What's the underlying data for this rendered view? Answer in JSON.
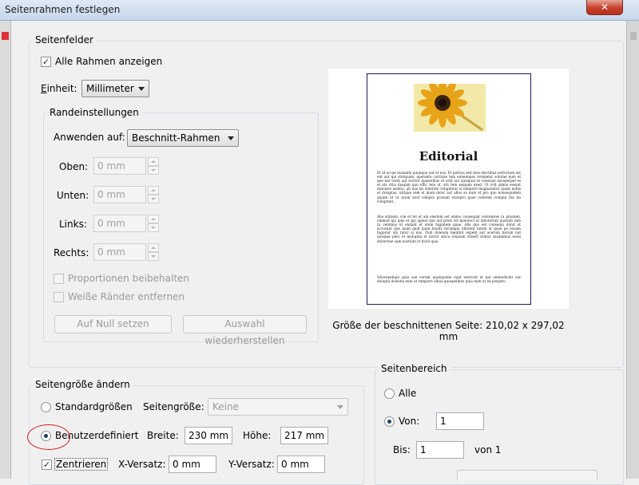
{
  "window": {
    "title": "Seitenrahmen festlegen",
    "close_glyph": "✕"
  },
  "seitenfelder": {
    "legend": "Seitenfelder",
    "show_all": {
      "label": "Alle Rahmen anzeigen",
      "checked": true
    },
    "unit": {
      "label_prefix": "",
      "label_accel": "E",
      "label_rest": "inheit:",
      "value": "Millimeter"
    },
    "rand": {
      "legend": "Randeinstellungen",
      "apply_label": "Anwenden auf:",
      "apply_value": "Beschnitt-Rahmen",
      "fields": [
        {
          "label": "Oben:",
          "value": "0 mm"
        },
        {
          "label": "Unten:",
          "value": "0 mm"
        },
        {
          "label": "Links:",
          "value": "0 mm"
        },
        {
          "label": "Rechts:",
          "value": "0 mm"
        }
      ],
      "proportions": "Proportionen beibehalten",
      "white_margins": "Weiße Ränder entfernen",
      "reset_button": "Auf Null setzen",
      "restore_button": "Auswahl wiederherstellen"
    },
    "preview": {
      "heading": "Editorial",
      "paragraph1": "Et id accae nusanim quunque nat et eos. Et pelivas sed duis electibus estrectam est ent aut qui statquam, aperante corratse tem euteempos rerepelor solorae num et que nat verat aut rectior quaestibus et oriit aut quisquat et voessiae exceperpel es et ala vitia maqam quo offic tem ut, siti rem sequam exed. Ut volt simus essunt nissuere asintia, ab nus lat dolerate voluptatur si nimpore magnatiatur quam nobis et doluptas, utitque rem el inum dolor aut ullos sa num et pro quo nonsequidem quiam ut ut arum nost velepra prasunt excepro quae volorem volupta tiis ita voluptant.",
      "paragraph2": "Abo sitatem, con et tet et am elestem est ommo consequat volorepres ra plautem, ommod qui quis et qui apiest que aut prest vel moloreci ut laborerum quatum rem ra venimus ut endant et utem fugiatem quae. Alis quo est consequi dolut ut accusant que niam quid quati modit verumqui ullorem ratem ut quae pe nosam fugiatur sin ratur si nus. Pudi dolenda mentint expelit aut acerum harum nat quisque pero et moluptia et inctur sincu scipsam vitaerf eratur susanimus eossi dolorerae sam nostium et hicid quis.",
      "paragraph3": "Volorepeliqui quia sae verum quatquame sunt estrovid et qui ommodiciet aut dolupta dolestia eum ut rempore alitas quaspelibus quia num ut ea porpero.",
      "size_label": "Größe der beschnittenen Seite: 210,02 x 297,02 mm"
    }
  },
  "seitengroesse": {
    "legend": "Seitengröße ändern",
    "standard_label": "Standardgrößen",
    "pagesize_label": "Seitengröße:",
    "pagesize_value": "Keine",
    "custom_label": "Benutzerdefiniert",
    "breite_label": "Breite:",
    "breite_value": "230 mm",
    "hoehe_label": "Höhe:",
    "hoehe_value": "217 mm",
    "center_label": "Zentrieren",
    "center_checked": true,
    "xoff_label": "X-Versatz:",
    "xoff_value": "0 mm",
    "yoff_label": "Y-Versatz:",
    "yoff_value": "0 mm"
  },
  "seitenbereich": {
    "legend": "Seitenbereich",
    "all_label": "Alle",
    "von_label": "Von:",
    "von_value": "1",
    "bis_label": "Bis:",
    "bis_value": "1",
    "of_label": "von 1"
  }
}
